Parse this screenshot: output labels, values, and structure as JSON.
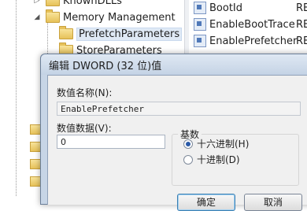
{
  "tree": {
    "items": [
      {
        "label": "KnownDLLs"
      },
      {
        "label": "Memory Management"
      },
      {
        "label": "PrefetchParameters"
      },
      {
        "label": "StoreParameters"
      }
    ]
  },
  "values": {
    "rows": [
      {
        "name": "BootId",
        "type": "REC"
      },
      {
        "name": "EnableBootTrace",
        "type": "REC"
      },
      {
        "name": "EnablePrefetcher",
        "type": "REC"
      }
    ]
  },
  "dialog": {
    "title": "编辑 DWORD (32 位)值",
    "value_name_label": "数值名称(N):",
    "value_name": "EnablePrefetcher",
    "value_data_label": "数值数据(V):",
    "value_data": "0",
    "base_label": "基数",
    "base_options": [
      {
        "label": "十六进制(H)",
        "selected": true
      },
      {
        "label": "十进制(D)",
        "selected": false
      }
    ],
    "ok_label": "确定",
    "cancel_label": "取消"
  }
}
